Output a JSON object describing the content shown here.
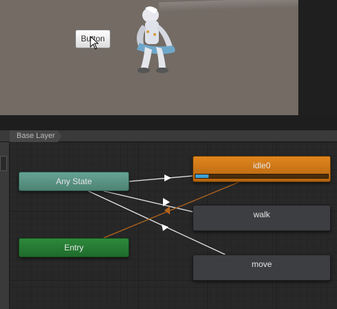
{
  "game_view": {
    "button_label": "Button"
  },
  "animator": {
    "breadcrumb": "Base Layer",
    "states": {
      "any_state": "Any State",
      "entry": "Entry",
      "idle": "idle0",
      "walk": "walk",
      "move": "move"
    },
    "idle_progress": 0.1
  },
  "colors": {
    "any_state": "#5a9584",
    "entry": "#26793a",
    "default_state": "#c87416",
    "state": "#3d3e41",
    "transition": "#e6e6e6",
    "default_transition": "#b5651d",
    "progress": "#3ea1d6"
  }
}
